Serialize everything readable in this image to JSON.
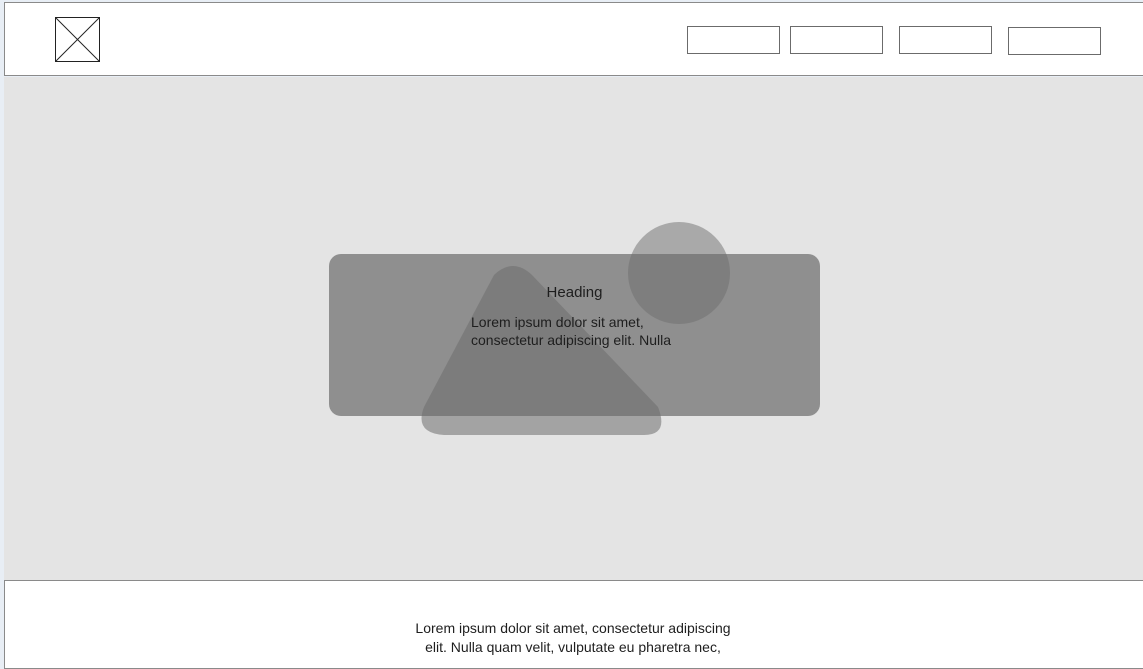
{
  "header": {
    "logo_icon": "image-placeholder-icon",
    "nav_buttons": [
      "",
      "",
      "",
      ""
    ]
  },
  "hero": {
    "card": {
      "heading": "Heading",
      "body_line1": "Lorem ipsum dolor sit amet,",
      "body_line2": "consectetur adipiscing elit. Nulla"
    },
    "decor": [
      "triangle-shape",
      "circle-shape"
    ],
    "colors": {
      "background": "#e4e4e4",
      "card": "#8f8f8f",
      "shapes": "#7a7a7a"
    }
  },
  "footer": {
    "text_line1": "Lorem ipsum dolor sit amet, consectetur adipiscing",
    "text_line2": "elit. Nulla quam velit, vulputate eu pharetra nec,"
  }
}
